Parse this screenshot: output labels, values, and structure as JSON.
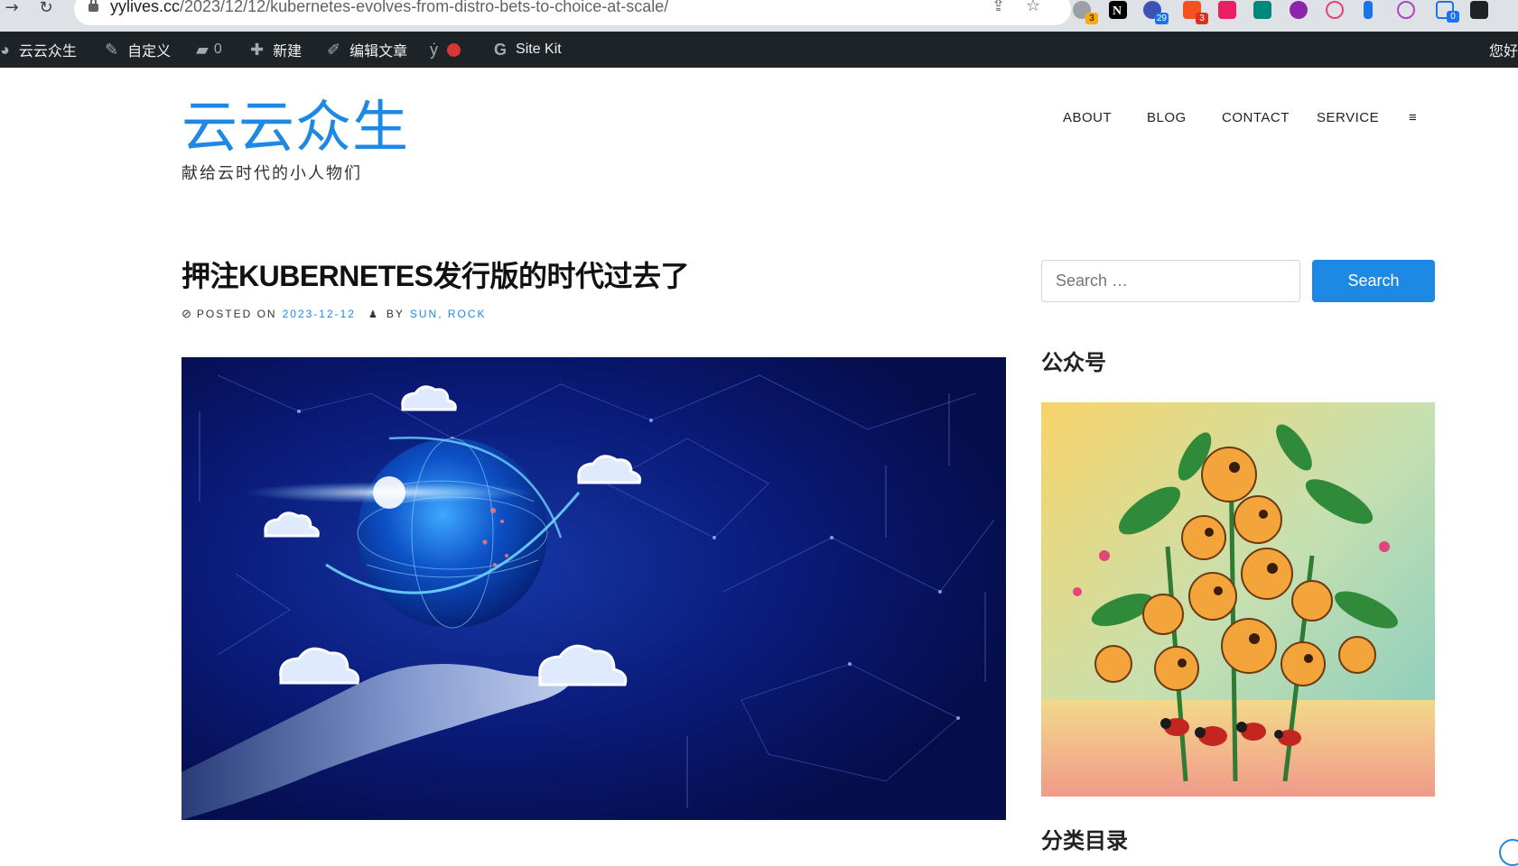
{
  "browser": {
    "url_host": "yylives.cc",
    "url_path": "/2023/12/12/kubernetes-evolves-from-distro-bets-to-choice-at-scale/",
    "extension_badges": [
      "3",
      "29",
      "3",
      "0"
    ]
  },
  "admin_bar": {
    "site_name": "云云众生",
    "customize": "自定义",
    "comments_count": "0",
    "new": "新建",
    "edit_post": "编辑文章",
    "site_kit": "Site Kit",
    "greeting": "您好"
  },
  "site": {
    "title": "云云众生",
    "tagline": "献给云时代的小人物们"
  },
  "menu": {
    "items": [
      "ABOUT",
      "BLOG",
      "CONTACT",
      "SERVICE"
    ],
    "toggle_glyph": "≡"
  },
  "post": {
    "title": "押注KUBERNETES发行版的时代过去了",
    "posted_on_label": "POSTED ON",
    "date": "2023-12-12",
    "by_label": "BY",
    "author": "SUN, ROCK"
  },
  "sidebar": {
    "search_placeholder": "Search …",
    "search_button": "Search",
    "wechat_title": "公众号",
    "categories_title": "分类目录"
  },
  "colors": {
    "accent": "#1e88e5",
    "admin_bar": "#1d2327",
    "hero_bg": "#07125a"
  }
}
